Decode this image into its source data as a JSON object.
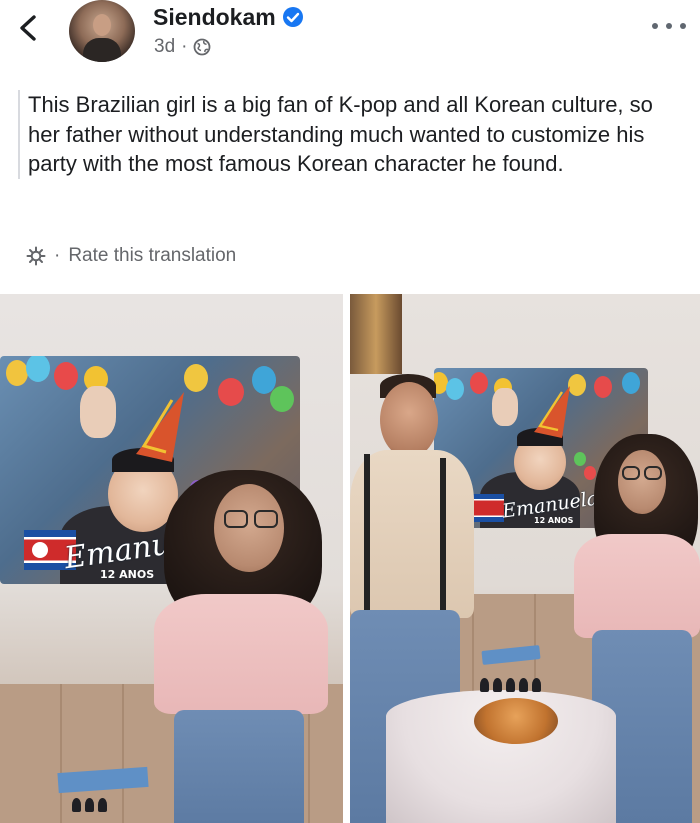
{
  "post": {
    "author": "Siendokam",
    "time": "3d",
    "separator": "·",
    "text": "This Brazilian girl is a big fan of K-pop and all Korean culture, so her father without understanding much wanted to customize his party with the most famous Korean character he found.",
    "translate_separator": "·",
    "rate_translation": "Rate this translation"
  },
  "photos": {
    "left": {
      "banner_name": "Emanuel",
      "banner_age": "12 ANOS"
    },
    "right": {
      "banner_name": "Emanuela",
      "banner_age": "12 ANOS"
    }
  },
  "icons": {
    "back": "chevron-left-icon",
    "verified": "verified-badge-icon",
    "audience": "globe-icon",
    "more": "more-options-icon",
    "translate": "gear-icon"
  },
  "colors": {
    "verified_blue": "#1877f2",
    "meta_gray": "#65676b",
    "text": "#1c1e21"
  }
}
